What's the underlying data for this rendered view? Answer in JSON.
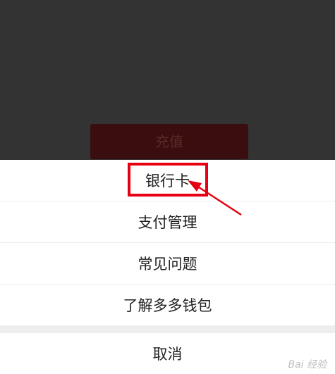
{
  "background": {
    "recharge_button_label": "充值"
  },
  "action_sheet": {
    "items": [
      {
        "label": "银行卡"
      },
      {
        "label": "支付管理"
      },
      {
        "label": "常见问题"
      },
      {
        "label": "了解多多钱包"
      }
    ],
    "cancel_label": "取消"
  },
  "annotation": {
    "highlight_color": "#e60012"
  },
  "watermark": {
    "text": "Bai 经验"
  }
}
